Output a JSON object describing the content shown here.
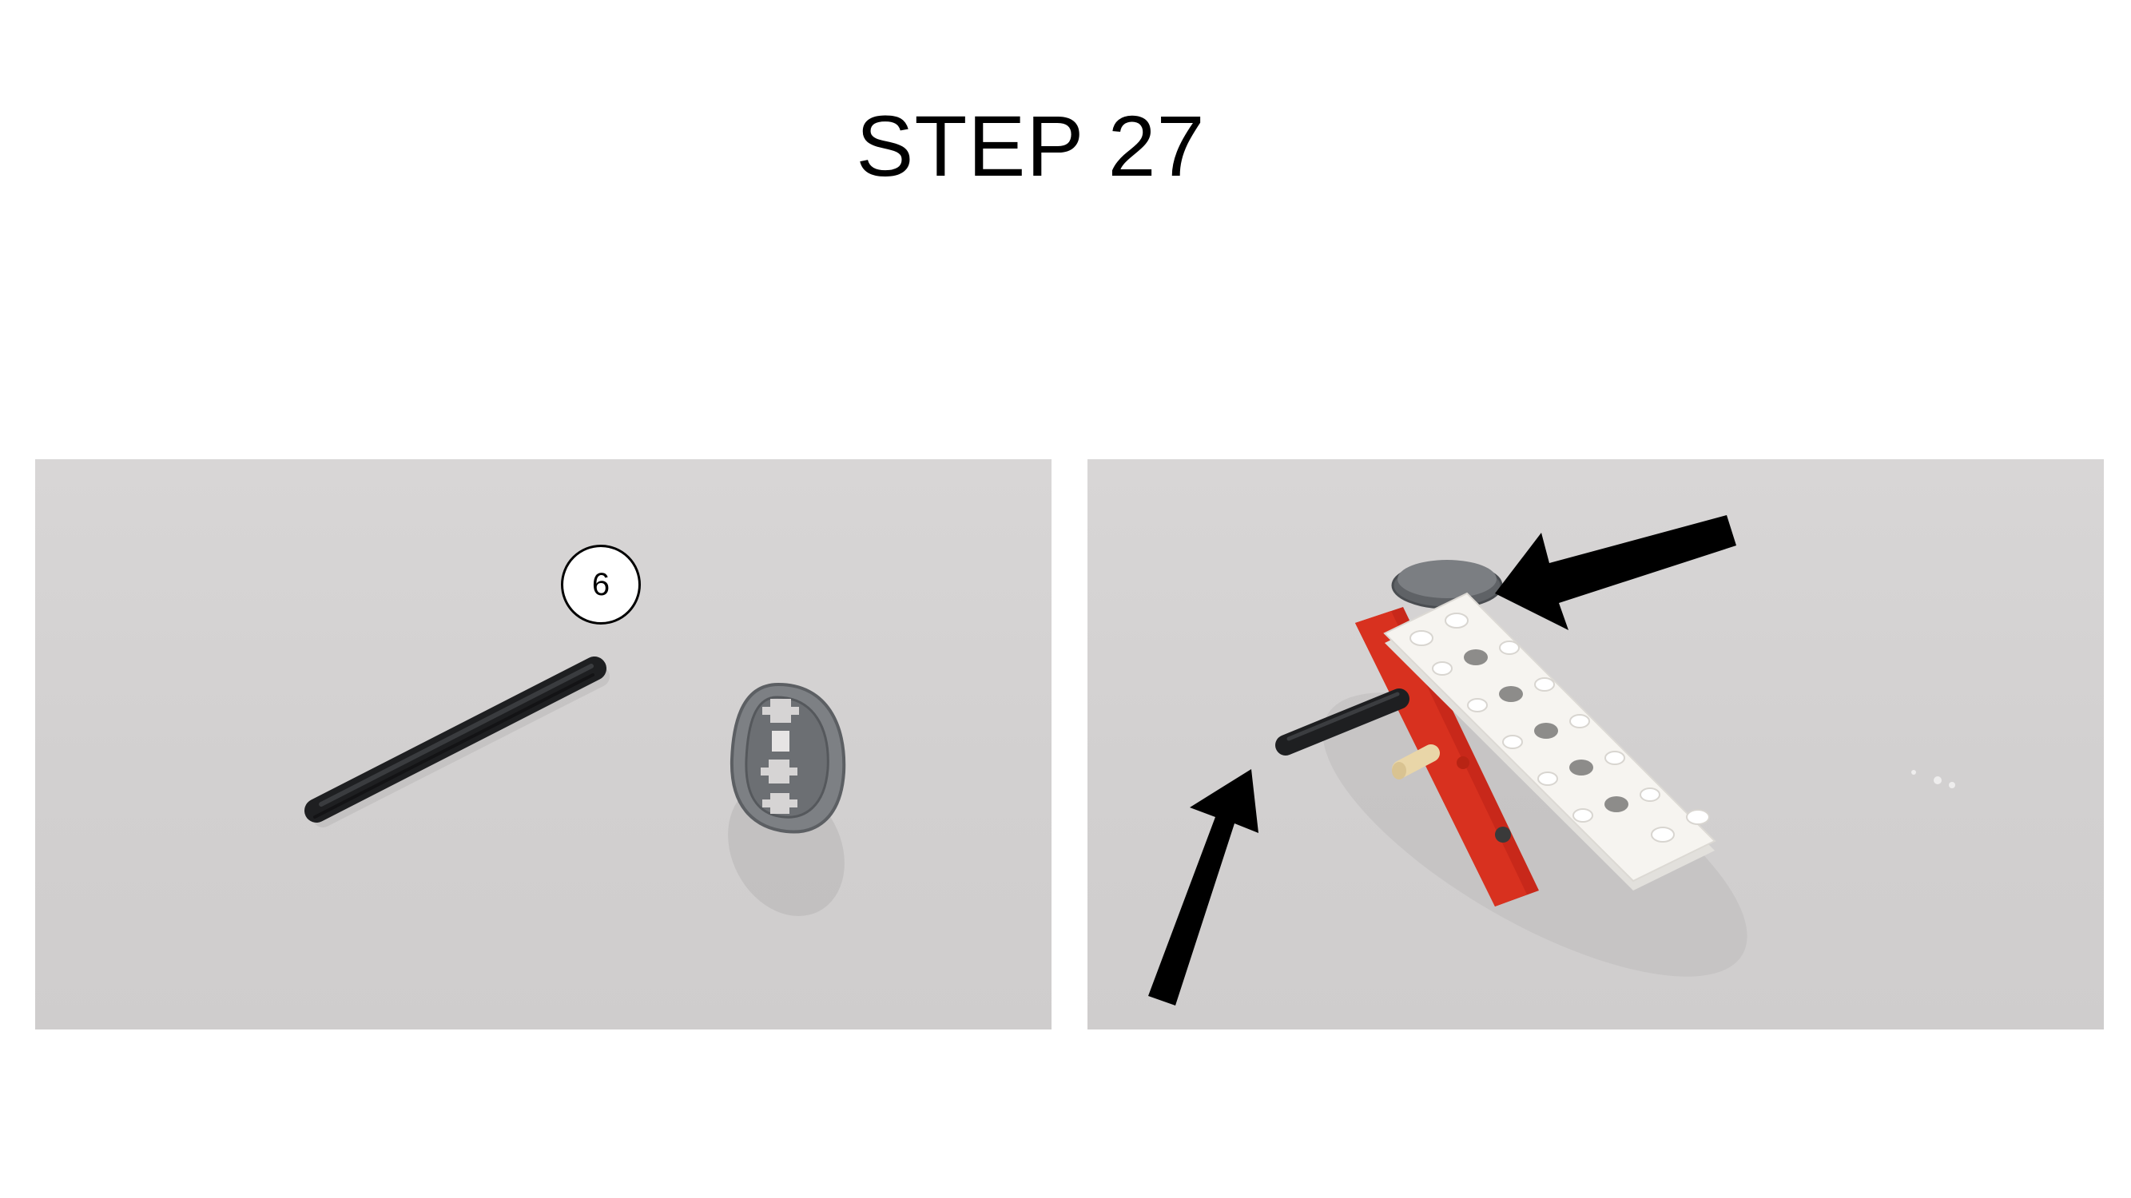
{
  "page": {
    "title": "STEP 27"
  },
  "left_photo": {
    "parts": [
      {
        "name": "axle-6",
        "quantity_label": "6",
        "color": "#1e1f21"
      },
      {
        "name": "wedge-belt-wheel",
        "color": "#7d8084"
      }
    ]
  },
  "right_photo": {
    "pointer_arrows": 2,
    "colors": {
      "plate": "#f6f4f0",
      "brick": "#d8311f",
      "wheel": "#6f7276",
      "axle": "#1e1f21",
      "pin": "#e9d6a8",
      "arrow": "#000000"
    }
  }
}
